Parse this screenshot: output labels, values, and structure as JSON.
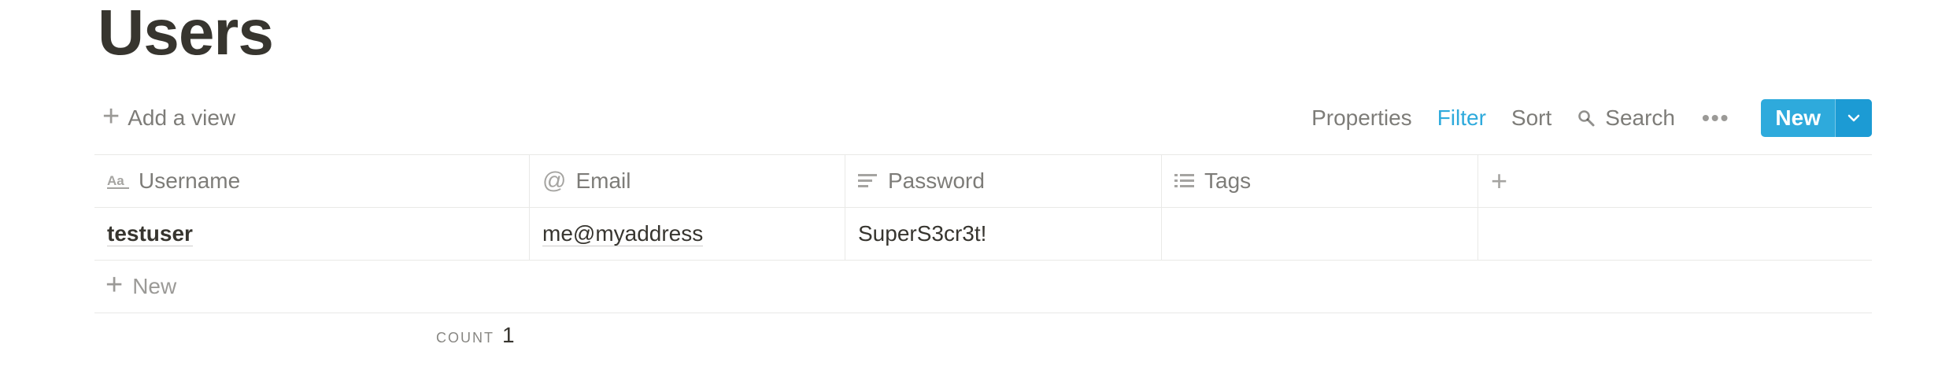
{
  "page": {
    "title": "Users"
  },
  "toolbar": {
    "add_view_label": "Add a view",
    "properties_label": "Properties",
    "filter_label": "Filter",
    "sort_label": "Sort",
    "search_label": "Search",
    "new_label": "New",
    "accent_color": "#2eaadc"
  },
  "table": {
    "columns": [
      {
        "label": "Username",
        "icon": "title-aa-icon"
      },
      {
        "label": "Email",
        "icon": "at-sign-icon"
      },
      {
        "label": "Password",
        "icon": "text-lines-icon"
      },
      {
        "label": "Tags",
        "icon": "list-icon"
      }
    ],
    "rows": [
      {
        "username": "testuser",
        "email": "me@myaddress",
        "password": "SuperS3cr3t!",
        "tags": ""
      }
    ],
    "new_row_label": "New"
  },
  "footer": {
    "count_label": "COUNT",
    "count_value": "1"
  }
}
